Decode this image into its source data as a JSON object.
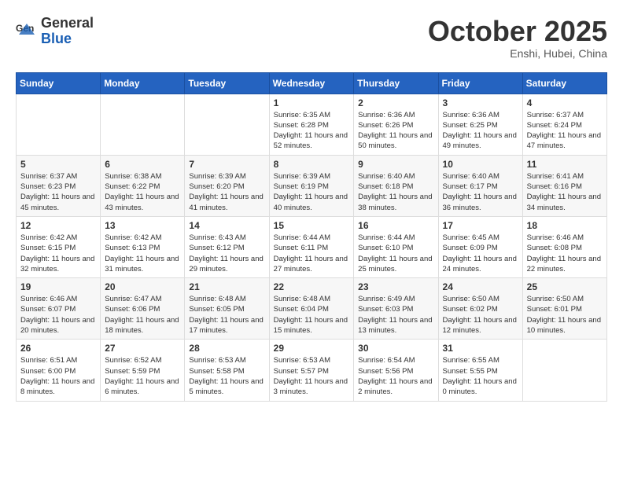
{
  "header": {
    "logo_general": "General",
    "logo_blue": "Blue",
    "month_title": "October 2025",
    "location": "Enshi, Hubei, China"
  },
  "days_of_week": [
    "Sunday",
    "Monday",
    "Tuesday",
    "Wednesday",
    "Thursday",
    "Friday",
    "Saturday"
  ],
  "weeks": [
    [
      {
        "day": "",
        "sunrise": "",
        "sunset": "",
        "daylight": ""
      },
      {
        "day": "",
        "sunrise": "",
        "sunset": "",
        "daylight": ""
      },
      {
        "day": "",
        "sunrise": "",
        "sunset": "",
        "daylight": ""
      },
      {
        "day": "1",
        "sunrise": "Sunrise: 6:35 AM",
        "sunset": "Sunset: 6:28 PM",
        "daylight": "Daylight: 11 hours and 52 minutes."
      },
      {
        "day": "2",
        "sunrise": "Sunrise: 6:36 AM",
        "sunset": "Sunset: 6:26 PM",
        "daylight": "Daylight: 11 hours and 50 minutes."
      },
      {
        "day": "3",
        "sunrise": "Sunrise: 6:36 AM",
        "sunset": "Sunset: 6:25 PM",
        "daylight": "Daylight: 11 hours and 49 minutes."
      },
      {
        "day": "4",
        "sunrise": "Sunrise: 6:37 AM",
        "sunset": "Sunset: 6:24 PM",
        "daylight": "Daylight: 11 hours and 47 minutes."
      }
    ],
    [
      {
        "day": "5",
        "sunrise": "Sunrise: 6:37 AM",
        "sunset": "Sunset: 6:23 PM",
        "daylight": "Daylight: 11 hours and 45 minutes."
      },
      {
        "day": "6",
        "sunrise": "Sunrise: 6:38 AM",
        "sunset": "Sunset: 6:22 PM",
        "daylight": "Daylight: 11 hours and 43 minutes."
      },
      {
        "day": "7",
        "sunrise": "Sunrise: 6:39 AM",
        "sunset": "Sunset: 6:20 PM",
        "daylight": "Daylight: 11 hours and 41 minutes."
      },
      {
        "day": "8",
        "sunrise": "Sunrise: 6:39 AM",
        "sunset": "Sunset: 6:19 PM",
        "daylight": "Daylight: 11 hours and 40 minutes."
      },
      {
        "day": "9",
        "sunrise": "Sunrise: 6:40 AM",
        "sunset": "Sunset: 6:18 PM",
        "daylight": "Daylight: 11 hours and 38 minutes."
      },
      {
        "day": "10",
        "sunrise": "Sunrise: 6:40 AM",
        "sunset": "Sunset: 6:17 PM",
        "daylight": "Daylight: 11 hours and 36 minutes."
      },
      {
        "day": "11",
        "sunrise": "Sunrise: 6:41 AM",
        "sunset": "Sunset: 6:16 PM",
        "daylight": "Daylight: 11 hours and 34 minutes."
      }
    ],
    [
      {
        "day": "12",
        "sunrise": "Sunrise: 6:42 AM",
        "sunset": "Sunset: 6:15 PM",
        "daylight": "Daylight: 11 hours and 32 minutes."
      },
      {
        "day": "13",
        "sunrise": "Sunrise: 6:42 AM",
        "sunset": "Sunset: 6:13 PM",
        "daylight": "Daylight: 11 hours and 31 minutes."
      },
      {
        "day": "14",
        "sunrise": "Sunrise: 6:43 AM",
        "sunset": "Sunset: 6:12 PM",
        "daylight": "Daylight: 11 hours and 29 minutes."
      },
      {
        "day": "15",
        "sunrise": "Sunrise: 6:44 AM",
        "sunset": "Sunset: 6:11 PM",
        "daylight": "Daylight: 11 hours and 27 minutes."
      },
      {
        "day": "16",
        "sunrise": "Sunrise: 6:44 AM",
        "sunset": "Sunset: 6:10 PM",
        "daylight": "Daylight: 11 hours and 25 minutes."
      },
      {
        "day": "17",
        "sunrise": "Sunrise: 6:45 AM",
        "sunset": "Sunset: 6:09 PM",
        "daylight": "Daylight: 11 hours and 24 minutes."
      },
      {
        "day": "18",
        "sunrise": "Sunrise: 6:46 AM",
        "sunset": "Sunset: 6:08 PM",
        "daylight": "Daylight: 11 hours and 22 minutes."
      }
    ],
    [
      {
        "day": "19",
        "sunrise": "Sunrise: 6:46 AM",
        "sunset": "Sunset: 6:07 PM",
        "daylight": "Daylight: 11 hours and 20 minutes."
      },
      {
        "day": "20",
        "sunrise": "Sunrise: 6:47 AM",
        "sunset": "Sunset: 6:06 PM",
        "daylight": "Daylight: 11 hours and 18 minutes."
      },
      {
        "day": "21",
        "sunrise": "Sunrise: 6:48 AM",
        "sunset": "Sunset: 6:05 PM",
        "daylight": "Daylight: 11 hours and 17 minutes."
      },
      {
        "day": "22",
        "sunrise": "Sunrise: 6:48 AM",
        "sunset": "Sunset: 6:04 PM",
        "daylight": "Daylight: 11 hours and 15 minutes."
      },
      {
        "day": "23",
        "sunrise": "Sunrise: 6:49 AM",
        "sunset": "Sunset: 6:03 PM",
        "daylight": "Daylight: 11 hours and 13 minutes."
      },
      {
        "day": "24",
        "sunrise": "Sunrise: 6:50 AM",
        "sunset": "Sunset: 6:02 PM",
        "daylight": "Daylight: 11 hours and 12 minutes."
      },
      {
        "day": "25",
        "sunrise": "Sunrise: 6:50 AM",
        "sunset": "Sunset: 6:01 PM",
        "daylight": "Daylight: 11 hours and 10 minutes."
      }
    ],
    [
      {
        "day": "26",
        "sunrise": "Sunrise: 6:51 AM",
        "sunset": "Sunset: 6:00 PM",
        "daylight": "Daylight: 11 hours and 8 minutes."
      },
      {
        "day": "27",
        "sunrise": "Sunrise: 6:52 AM",
        "sunset": "Sunset: 5:59 PM",
        "daylight": "Daylight: 11 hours and 6 minutes."
      },
      {
        "day": "28",
        "sunrise": "Sunrise: 6:53 AM",
        "sunset": "Sunset: 5:58 PM",
        "daylight": "Daylight: 11 hours and 5 minutes."
      },
      {
        "day": "29",
        "sunrise": "Sunrise: 6:53 AM",
        "sunset": "Sunset: 5:57 PM",
        "daylight": "Daylight: 11 hours and 3 minutes."
      },
      {
        "day": "30",
        "sunrise": "Sunrise: 6:54 AM",
        "sunset": "Sunset: 5:56 PM",
        "daylight": "Daylight: 11 hours and 2 minutes."
      },
      {
        "day": "31",
        "sunrise": "Sunrise: 6:55 AM",
        "sunset": "Sunset: 5:55 PM",
        "daylight": "Daylight: 11 hours and 0 minutes."
      },
      {
        "day": "",
        "sunrise": "",
        "sunset": "",
        "daylight": ""
      }
    ]
  ]
}
